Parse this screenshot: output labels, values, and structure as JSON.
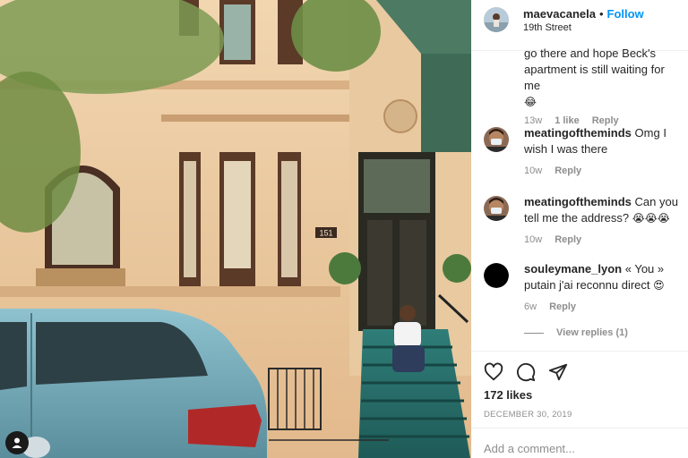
{
  "post": {
    "username": "maevacanela",
    "dot": "•",
    "follow_label": "Follow",
    "location": "19th Street",
    "caption_tail_line1": "go there and hope Beck's",
    "caption_tail_line2": "apartment is still waiting for me",
    "caption_emoji": "😂",
    "caption_time": "13w",
    "caption_likes": "1 like",
    "reply_label": "Reply"
  },
  "comments": [
    {
      "user": "meatingoftheminds",
      "text": "Omg I wish I was there",
      "time": "10w",
      "reply": "Reply"
    },
    {
      "user": "meatingoftheminds",
      "text": "Can you tell me the address?",
      "emoji": "😭😭😭",
      "time": "10w",
      "reply": "Reply"
    },
    {
      "user": "souleymane_lyon",
      "text": "« You » putain j'ai reconnu direct",
      "emoji": "😍",
      "time": "6w",
      "reply": "Reply"
    }
  ],
  "view_replies": "View replies (1)",
  "likes": "172 likes",
  "date": "DECEMBER 30, 2019",
  "add_comment_placeholder": "Add a comment...",
  "icons": {
    "like": "heart-icon",
    "comment": "comment-icon",
    "share": "paper-plane-icon",
    "user_tag": "user-tag-icon"
  },
  "colors": {
    "follow": "#0095f6",
    "muted": "#8e8e8e",
    "text": "#262626",
    "divider": "#efefef"
  },
  "photo": {
    "address_number": "151"
  }
}
